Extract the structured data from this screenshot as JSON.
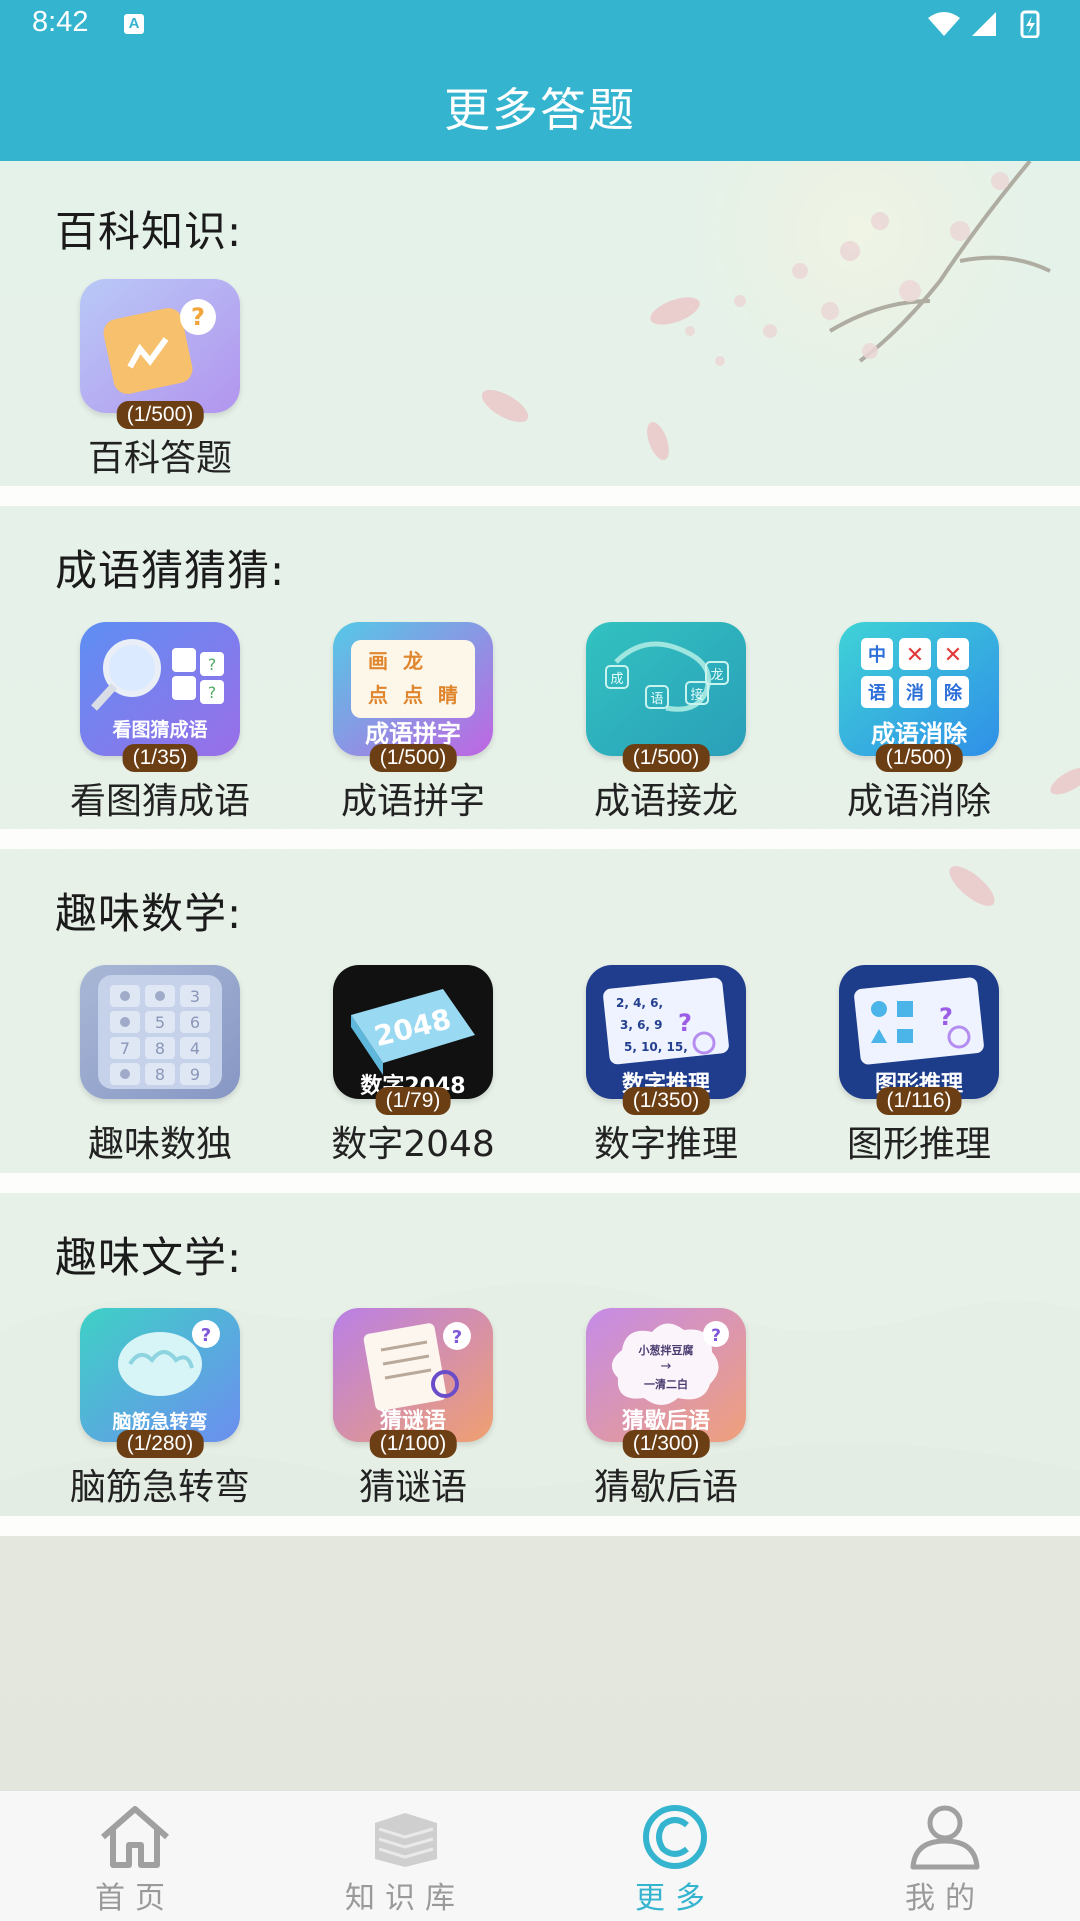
{
  "status_bar": {
    "time": "8:42",
    "notification_badge": "A"
  },
  "header": {
    "title": "更多答题",
    "background": "#35b4cf"
  },
  "badge_color": "#6b3e14",
  "sections": [
    {
      "title": "百科知识:",
      "items": [
        {
          "label": "百科答题",
          "progress": "(1/500)",
          "icon": "encyclopedia-quiz-icon",
          "icon_text": ""
        }
      ]
    },
    {
      "title": "成语猜猜猜:",
      "items": [
        {
          "label": "看图猜成语",
          "progress": "(1/35)",
          "icon": "guess-idiom-picture-icon",
          "icon_text": "看图猜成语"
        },
        {
          "label": "成语拼字",
          "progress": "(1/500)",
          "icon": "idiom-spelling-icon",
          "icon_text": "成语拼字"
        },
        {
          "label": "成语接龙",
          "progress": "(1/500)",
          "icon": "idiom-chain-icon",
          "icon_text": ""
        },
        {
          "label": "成语消除",
          "progress": "(1/500)",
          "icon": "idiom-eliminate-icon",
          "icon_text": "成语消除"
        }
      ]
    },
    {
      "title": "趣味数学:",
      "items": [
        {
          "label": "趣味数独",
          "progress": "",
          "icon": "sudoku-icon",
          "icon_text": ""
        },
        {
          "label": "数字2048",
          "progress": "(1/79)",
          "icon": "number-2048-icon",
          "icon_text": "数字2048"
        },
        {
          "label": "数字推理",
          "progress": "(1/350)",
          "icon": "number-reasoning-icon",
          "icon_text": "数字推理"
        },
        {
          "label": "图形推理",
          "progress": "(1/116)",
          "icon": "shape-reasoning-icon",
          "icon_text": "图形推理"
        }
      ]
    },
    {
      "title": "趣味文学:",
      "items": [
        {
          "label": "脑筋急转弯",
          "progress": "(1/280)",
          "icon": "brain-teaser-icon",
          "icon_text": "脑筋急转弯"
        },
        {
          "label": "猜谜语",
          "progress": "(1/100)",
          "icon": "riddle-icon",
          "icon_text": "猜谜语"
        },
        {
          "label": "猜歇后语",
          "progress": "(1/300)",
          "icon": "xiehouyu-icon",
          "icon_text": "猜歇后语"
        }
      ]
    }
  ],
  "icon_art": {
    "chain_chars": [
      "成",
      "语",
      "接",
      "龙"
    ],
    "eliminate_chars": [
      "中",
      "语",
      "消",
      "除"
    ],
    "spelling_chars": [
      "画",
      "龙",
      "点",
      "点",
      "睛"
    ],
    "sudoku_digits": [
      "3",
      "5",
      "6",
      "7",
      "8",
      "4",
      "8",
      "9"
    ],
    "tile_2048": "2048",
    "number_seq": [
      "2, 4, 6,",
      "3, 6, 9",
      "5, 10, 15,"
    ],
    "xiehouyu_lines": [
      "小葱拌豆腐",
      "一清二白"
    ]
  },
  "bottom_nav": {
    "active_color": "#35b4cf",
    "items": [
      {
        "label": "首页",
        "icon": "home-icon",
        "active": false
      },
      {
        "label": "知识库",
        "icon": "books-icon",
        "active": false
      },
      {
        "label": "更多",
        "icon": "copyright-icon",
        "active": true
      },
      {
        "label": "我的",
        "icon": "person-icon",
        "active": false
      }
    ]
  }
}
